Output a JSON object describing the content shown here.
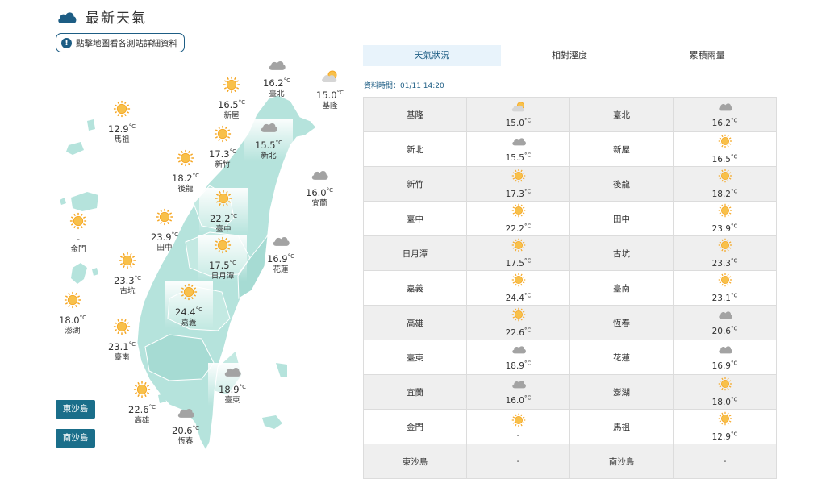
{
  "header": {
    "title": "最新天氣",
    "hint": "點擊地圖看各測站詳細資料",
    "hint_icon": "info-icon"
  },
  "tabs": [
    {
      "label": "天氣狀況",
      "active": true
    },
    {
      "label": "相對溼度",
      "active": false
    },
    {
      "label": "累積雨量",
      "active": false
    }
  ],
  "update_time": "資料時間：01/11 14:20",
  "map_stations": [
    {
      "name": "臺北",
      "temp": "16.2",
      "icon": "cloudy",
      "highlight": false
    },
    {
      "name": "基隆",
      "temp": "15.0",
      "icon": "partly-cloudy",
      "highlight": false
    },
    {
      "name": "新屋",
      "temp": "16.5",
      "icon": "sunny",
      "highlight": false
    },
    {
      "name": "新北",
      "temp": "15.5",
      "icon": "cloudy",
      "highlight": true
    },
    {
      "name": "新竹",
      "temp": "17.3",
      "icon": "sunny",
      "highlight": false
    },
    {
      "name": "後龍",
      "temp": "18.2",
      "icon": "sunny",
      "highlight": false
    },
    {
      "name": "宜蘭",
      "temp": "16.0",
      "icon": "cloudy",
      "highlight": false
    },
    {
      "name": "臺中",
      "temp": "22.2",
      "icon": "sunny",
      "highlight": true
    },
    {
      "name": "田中",
      "temp": "23.9",
      "icon": "sunny",
      "highlight": false
    },
    {
      "name": "日月潭",
      "temp": "17.5",
      "icon": "sunny",
      "highlight": true
    },
    {
      "name": "花蓮",
      "temp": "16.9",
      "icon": "cloudy",
      "highlight": false
    },
    {
      "name": "古坑",
      "temp": "23.3",
      "icon": "sunny",
      "highlight": false
    },
    {
      "name": "嘉義",
      "temp": "24.4",
      "icon": "sunny",
      "highlight": true
    },
    {
      "name": "臺南",
      "temp": "23.1",
      "icon": "sunny",
      "highlight": false
    },
    {
      "name": "高雄",
      "temp": "22.6",
      "icon": "sunny",
      "highlight": false
    },
    {
      "name": "臺東",
      "temp": "18.9",
      "icon": "cloudy",
      "highlight": true
    },
    {
      "name": "恆春",
      "temp": "20.6",
      "icon": "cloudy",
      "highlight": false
    },
    {
      "name": "馬祖",
      "temp": "12.9",
      "icon": "sunny",
      "highlight": false
    },
    {
      "name": "金門",
      "temp": "-",
      "icon": "sunny",
      "highlight": false
    },
    {
      "name": "澎湖",
      "temp": "18.0",
      "icon": "sunny",
      "highlight": false
    }
  ],
  "unit": "°C",
  "island_buttons": [
    "東沙島",
    "南沙島"
  ],
  "table_rows": [
    [
      {
        "name": "基隆",
        "temp": "15.0",
        "icon": "partly-cloudy"
      },
      {
        "name": "臺北",
        "temp": "16.2",
        "icon": "cloudy"
      }
    ],
    [
      {
        "name": "新北",
        "temp": "15.5",
        "icon": "cloudy"
      },
      {
        "name": "新屋",
        "temp": "16.5",
        "icon": "sunny"
      }
    ],
    [
      {
        "name": "新竹",
        "temp": "17.3",
        "icon": "sunny"
      },
      {
        "name": "後龍",
        "temp": "18.2",
        "icon": "sunny"
      }
    ],
    [
      {
        "name": "臺中",
        "temp": "22.2",
        "icon": "sunny"
      },
      {
        "name": "田中",
        "temp": "23.9",
        "icon": "sunny"
      }
    ],
    [
      {
        "name": "日月潭",
        "temp": "17.5",
        "icon": "sunny"
      },
      {
        "name": "古坑",
        "temp": "23.3",
        "icon": "sunny"
      }
    ],
    [
      {
        "name": "嘉義",
        "temp": "24.4",
        "icon": "sunny"
      },
      {
        "name": "臺南",
        "temp": "23.1",
        "icon": "sunny"
      }
    ],
    [
      {
        "name": "高雄",
        "temp": "22.6",
        "icon": "sunny"
      },
      {
        "name": "恆春",
        "temp": "20.6",
        "icon": "cloudy"
      }
    ],
    [
      {
        "name": "臺東",
        "temp": "18.9",
        "icon": "cloudy"
      },
      {
        "name": "花蓮",
        "temp": "16.9",
        "icon": "cloudy"
      }
    ],
    [
      {
        "name": "宜蘭",
        "temp": "16.0",
        "icon": "cloudy"
      },
      {
        "name": "澎湖",
        "temp": "18.0",
        "icon": "sunny"
      }
    ],
    [
      {
        "name": "金門",
        "temp": "-",
        "icon": "sunny"
      },
      {
        "name": "馬祖",
        "temp": "12.9",
        "icon": "sunny"
      }
    ],
    [
      {
        "name": "東沙島",
        "temp": "-",
        "icon": ""
      },
      {
        "name": "南沙島",
        "temp": "-",
        "icon": ""
      }
    ]
  ],
  "colors": {
    "accent": "#1d5d84",
    "map_fill": "#b5e3dc",
    "button": "#1a6e8a",
    "sun": "#f5a623",
    "cloud": "#999999"
  }
}
